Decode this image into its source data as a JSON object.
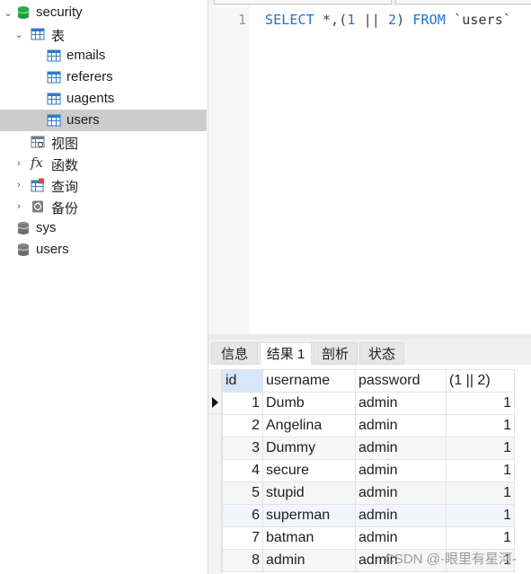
{
  "navigator": {
    "items": [
      {
        "label": "security",
        "icon": "database-icon",
        "expanded": true
      },
      {
        "label": "表",
        "icon": "table-group-icon",
        "expanded": true
      },
      {
        "label": "emails",
        "icon": "table-icon"
      },
      {
        "label": "referers",
        "icon": "table-icon"
      },
      {
        "label": "uagents",
        "icon": "table-icon"
      },
      {
        "label": "users",
        "icon": "table-icon",
        "selected": true
      },
      {
        "label": "视图",
        "icon": "view-icon"
      },
      {
        "label": "函数",
        "icon": "function-icon",
        "collapsed": true
      },
      {
        "label": "查询",
        "icon": "query-icon",
        "collapsed": true
      },
      {
        "label": "备份",
        "icon": "backup-icon",
        "collapsed": true
      },
      {
        "label": "sys",
        "icon": "database-icon"
      },
      {
        "label": "users",
        "icon": "database-icon"
      }
    ]
  },
  "editor": {
    "line_number": "1",
    "sql": {
      "kw1": "SELECT",
      "p1": " *,(",
      "n1": "1",
      "op": " || ",
      "n2": "2",
      "p2": ") ",
      "kw2": "FROM",
      "tbl": " `users`"
    }
  },
  "result_tabs": [
    {
      "label": "信息"
    },
    {
      "label": "结果 1",
      "active": true
    },
    {
      "label": "剖析"
    },
    {
      "label": "状态"
    }
  ],
  "results": {
    "columns": [
      "id",
      "username",
      "password",
      "(1 || 2)"
    ],
    "rows": [
      [
        "1",
        "Dumb",
        "admin",
        "1"
      ],
      [
        "2",
        "Angelina",
        "admin",
        "1"
      ],
      [
        "3",
        "Dummy",
        "admin",
        "1"
      ],
      [
        "4",
        "secure",
        "admin",
        "1"
      ],
      [
        "5",
        "stupid",
        "admin",
        "1"
      ],
      [
        "6",
        "superman",
        "admin",
        "1"
      ],
      [
        "7",
        "batman",
        "admin",
        "1"
      ],
      [
        "8",
        "admin",
        "admin",
        "1"
      ]
    ]
  },
  "watermark": "CSDN @-眼里有星河-",
  "colors": {
    "accent": "#1f6fd6",
    "db_green": "#27a845",
    "selection": "#cccccc"
  }
}
